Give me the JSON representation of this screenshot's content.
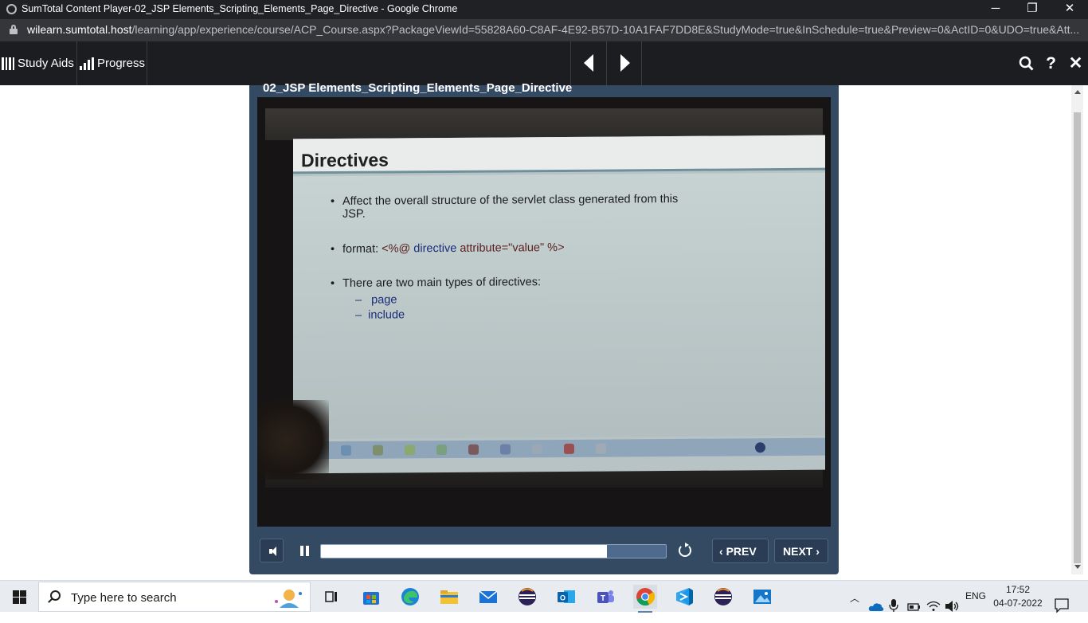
{
  "window": {
    "title": "SumTotal Content Player-02_JSP Elements_Scripting_Elements_Page_Directive - Google Chrome",
    "minimize": "─",
    "restore": "❐",
    "close": "✕"
  },
  "address": {
    "host": "wilearn.sumtotal.host",
    "path": "/learning/app/experience/course/ACP_Course.aspx?PackageViewId=55828A60-C8AF-4E92-B57D-10A1FAF7DD8E&StudyMode=true&InSchedule=true&Preview=0&ActID=0&UDO=true&Att..."
  },
  "topbar": {
    "study_aids": "Study Aids",
    "progress": "Progress",
    "search_glyph": "🔍",
    "help_glyph": "?",
    "close_glyph": "✕"
  },
  "player": {
    "title": "02_JSP Elements_Scripting_Elements_Page_Directive",
    "progress_fraction": 0.83,
    "prev_label": "PREV",
    "next_label": "NEXT"
  },
  "slide": {
    "heading": "Directives",
    "bullet1_line1": "Affect the overall structure of the servlet class generated from this",
    "bullet1_line2": "JSP.",
    "bullet2_prefix": "format: ",
    "bullet2_open": "<%@",
    "bullet2_directive": "directive",
    "bullet2_attr": "attribute=\"value\"",
    "bullet2_close": "%>",
    "bullet3": "There are two main types of directives:",
    "sub1": "page",
    "sub2": "include"
  },
  "taskbar": {
    "search_placeholder": "Type here to search",
    "language": "ENG",
    "time": "17:52",
    "date": "04-07-2022"
  }
}
